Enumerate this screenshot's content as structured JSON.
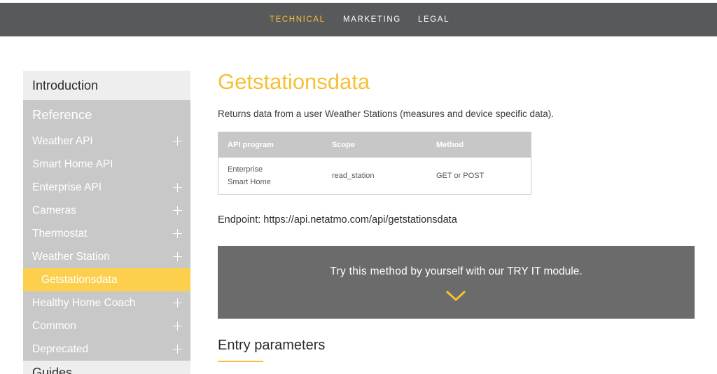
{
  "topnav": {
    "items": [
      {
        "label": "TECHNICAL",
        "active": true
      },
      {
        "label": "MARKETING",
        "active": false
      },
      {
        "label": "LEGAL",
        "active": false
      }
    ]
  },
  "sidebar": {
    "intro": "Introduction",
    "reference": "Reference",
    "items": [
      {
        "label": "Weather API",
        "expandable": true
      },
      {
        "label": "Smart Home API",
        "expandable": false
      },
      {
        "label": "Enterprise API",
        "expandable": true
      },
      {
        "label": "Cameras",
        "expandable": true
      },
      {
        "label": "Thermostat",
        "expandable": true
      },
      {
        "label": "Weather Station",
        "expandable": true
      },
      {
        "label": "Getstationsdata",
        "expandable": false,
        "active": true
      },
      {
        "label": "Healthy Home Coach",
        "expandable": true
      },
      {
        "label": "Common",
        "expandable": true
      },
      {
        "label": "Deprecated",
        "expandable": true
      }
    ],
    "guides": "Guides"
  },
  "main": {
    "title": "Getstationsdata",
    "description": "Returns data from a user Weather Stations (measures and device specific data).",
    "table": {
      "headers": [
        "API program",
        "Scope",
        "Method"
      ],
      "row": {
        "program_line1": "Enterprise",
        "program_line2": "Smart Home",
        "scope": "read_station",
        "method": "GET or POST"
      }
    },
    "endpoint": "Endpoint: https://api.netatmo.com/api/getstationsdata",
    "tryit": {
      "strong": "Try this method",
      "rest": " by yourself with our TRY IT module."
    },
    "entry_title": "Entry parameters"
  },
  "colors": {
    "accent": "#f5c033",
    "nav_bg": "#58595b",
    "sidebar_grey": "#c8c8c8",
    "sidebar_active": "#fccf4d",
    "tryit_bg": "#6b6b6b"
  }
}
